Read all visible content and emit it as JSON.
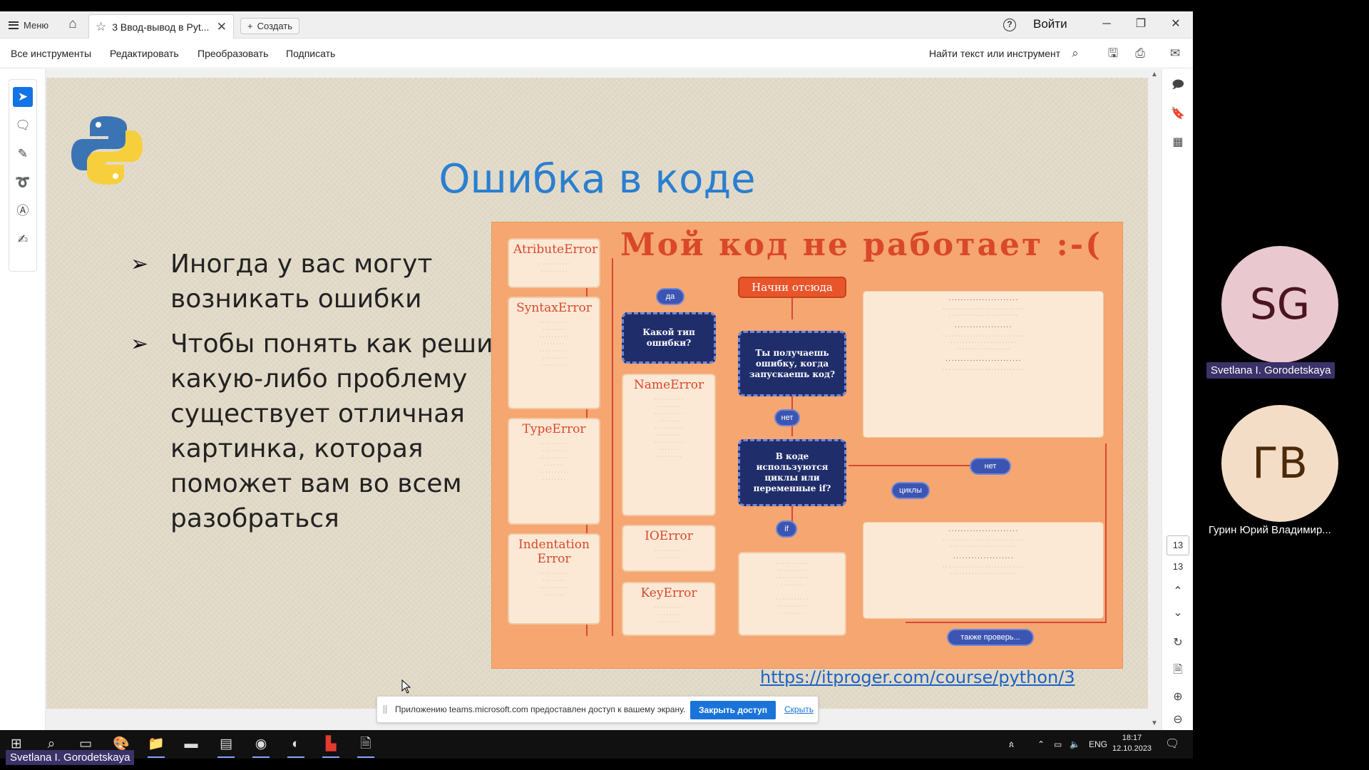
{
  "titlebar": {
    "menu_label": "Меню",
    "tab_title": "3 Ввод-вывод в Pyt...",
    "create_label": "Создать",
    "signin_label": "Войти"
  },
  "toolbar": {
    "all_tools": "Все инструменты",
    "edit": "Редактировать",
    "convert": "Преобразовать",
    "sign": "Подписать",
    "find_placeholder": "Найти текст или инструмент"
  },
  "slide": {
    "title": "Ошибка в коде",
    "bullets": [
      "Иногда у вас могут возникать ошибки",
      "Чтобы понять как решить какую-либо проблему существует отличная картинка, которая поможет вам во всем разобраться"
    ],
    "link": "https://itproger.com/course/python/3"
  },
  "infographic": {
    "title": "Мой код не работает :-(",
    "start": "Начни отсюда",
    "q_error_on_run": "Ты получаешь ошибку, когда запускаешь код?",
    "q_error_type": "Какой тип ошибки?",
    "q_loops": "В коде используются циклы или переменные if?",
    "pill_yes": "да",
    "pill_no": "нет",
    "pill_no2": "нет",
    "pill_loops": "циклы",
    "pill_if": "if",
    "pill_also": "также проверь...",
    "errors_left": [
      "AtributeError",
      "SyntaxError",
      "TypeError",
      "Indentation Error"
    ],
    "errors_mid": [
      "NameError",
      "IOError",
      "KeyError"
    ]
  },
  "sharebar": {
    "message": "Приложению teams.microsoft.com предоставлен доступ к вашему экрану.",
    "stop_label": "Закрыть доступ",
    "hide_label": "Скрыть"
  },
  "right_rail": {
    "page_current": "13",
    "page_total": "13"
  },
  "participants": [
    {
      "initials": "SG",
      "name": "Svetlana I. Gorodetskaya"
    },
    {
      "initials": "ГВ",
      "name": "Гурин Юрий Владимир..."
    }
  ],
  "taskbar": {
    "lang": "ENG",
    "time": "18:17",
    "date": "12.10.2023"
  },
  "presenter_name": "Svetlana I. Gorodetskaya"
}
